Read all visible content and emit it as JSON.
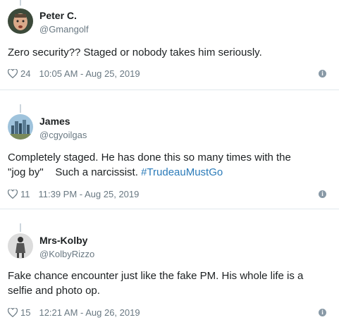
{
  "tweets": [
    {
      "name": "Peter C.",
      "handle": "@Gmangolf",
      "text": "Zero security?? Staged or nobody takes him seriously.",
      "text2": "",
      "hashtag": "",
      "likes": "24",
      "time": "10:05 AM - Aug 25, 2019"
    },
    {
      "name": "James",
      "handle": "@cgyoilgas",
      "text": "Completely staged. He has done this so many times with the",
      "text2": "\"jog by\"    Such a narcissist. ",
      "hashtag": "#TrudeauMustGo",
      "likes": "11",
      "time": "11:39 PM - Aug 25, 2019"
    },
    {
      "name": "Mrs-Kolby",
      "handle": "@KolbyRizzo",
      "text": "Fake chance encounter just like the fake PM. His whole life is a",
      "text2": "selfie and photo op.",
      "hashtag": "",
      "likes": "15",
      "time": "12:21 AM - Aug 26, 2019"
    }
  ],
  "info_symbol": "i",
  "colors": {
    "link": "#2b7bb9",
    "meta": "#697882",
    "divider": "#e1e8ed"
  }
}
